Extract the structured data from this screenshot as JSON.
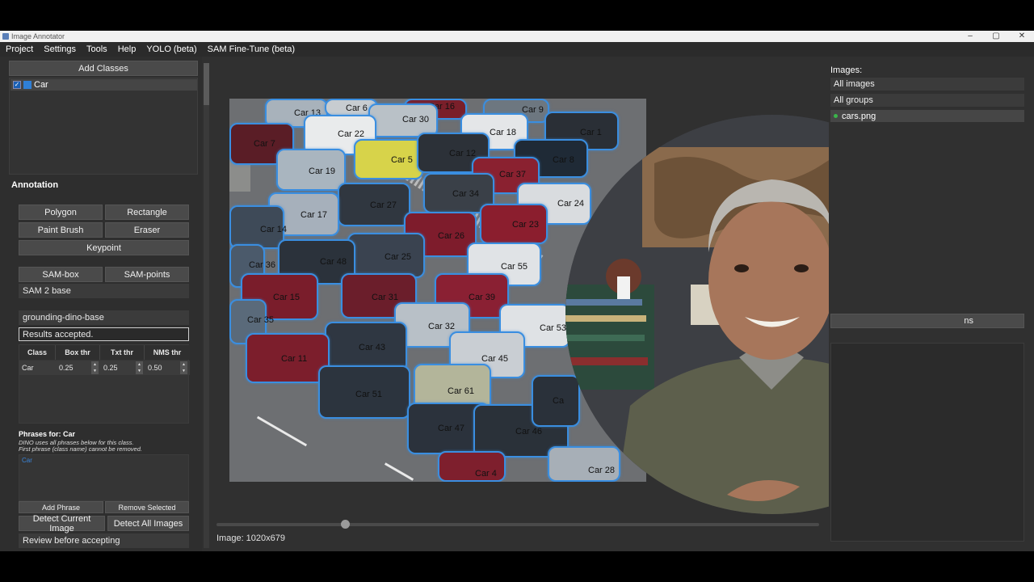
{
  "window": {
    "title": "Image Annotator",
    "controls": [
      "–",
      "▢",
      "✕"
    ]
  },
  "menu": [
    "Project",
    "Settings",
    "Tools",
    "Help",
    "YOLO (beta)",
    "SAM Fine-Tune (beta)"
  ],
  "left": {
    "add_classes": "Add Classes",
    "classes": [
      {
        "name": "Car",
        "checked": true,
        "color": "#2f7fd6"
      }
    ],
    "annotation_title": "Annotation",
    "tools": {
      "polygon": "Polygon",
      "rectangle": "Rectangle",
      "paint_brush": "Paint Brush",
      "eraser": "Eraser",
      "keypoint": "Keypoint",
      "sam_box": "SAM-box",
      "sam_points": "SAM-points"
    },
    "sam_model": "SAM 2 base",
    "dino_model": "grounding-dino-base",
    "results_status": "Results accepted.",
    "threshold_table": {
      "headers": [
        "Class",
        "Box thr",
        "Txt thr",
        "NMS thr"
      ],
      "rows": [
        {
          "class": "Car",
          "box": "0.25",
          "txt": "0.25",
          "nms": "0.50"
        }
      ]
    },
    "phrases_for": "Phrases for:  Car",
    "note1": "DINO uses all phrases below for this class.",
    "note2": "First phrase (class name) cannot be removed.",
    "phrases": [
      "Car"
    ],
    "add_phrase": "Add Phrase",
    "remove_selected": "Remove Selected",
    "detect_current": "Detect Current Image",
    "detect_all": "Detect All Images",
    "review": "Review before accepting"
  },
  "canvas": {
    "image_info": "Image: 1020x679",
    "slider_value": 0.21,
    "car_labels": [
      "Car 13",
      "Car 6",
      "Car 16",
      "Car 9",
      "Car 30",
      "Car 18",
      "Car 1",
      "Car 7",
      "Car 22",
      "Car 5",
      "Car 12",
      "Car 8",
      "Car 19",
      "Car 37",
      "Car 34",
      "Car 24",
      "Car 27",
      "Car 17",
      "Car 23",
      "Car 14",
      "Car 26",
      "Car 25",
      "Car 36",
      "Car 48",
      "Car 55",
      "Car 15",
      "Car 31",
      "Car 39",
      "Car 35",
      "Car 32",
      "Car 53",
      "Car 43",
      "Car 11",
      "Car 45",
      "Car 51",
      "Car 61",
      "Car 47",
      "Car 46",
      "Car 4",
      "Car 28",
      "Ca"
    ]
  },
  "right": {
    "images_label": "Images:",
    "all_images": "All images",
    "all_groups": "All groups",
    "files": [
      "cars.png"
    ],
    "partial_button": "ns"
  }
}
